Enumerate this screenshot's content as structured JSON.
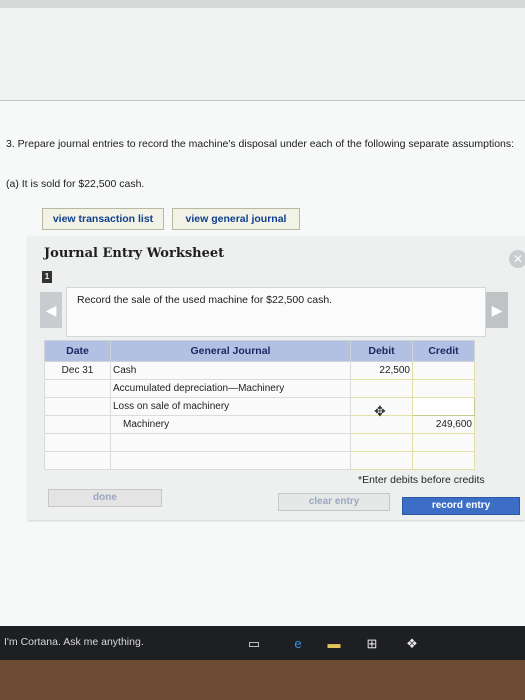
{
  "question": {
    "text": "3. Prepare journal entries to record the machine's disposal under each of the following separate assumptions:",
    "sub_a": "(a) It is sold for $22,500 cash."
  },
  "buttons": {
    "view_transaction_list": "view transaction list",
    "view_general_journal": "view general journal",
    "done": "done",
    "clear_entry": "clear entry",
    "record_entry": "record entry"
  },
  "worksheet": {
    "title": "Journal Entry Worksheet",
    "step": "1",
    "instruction": "Record the sale of the used machine for $22,500 cash.",
    "close_icon": "close-icon",
    "nav_left_icon": "chevron-left-icon",
    "nav_right_icon": "chevron-right-icon"
  },
  "journal": {
    "headers": [
      "Date",
      "General Journal",
      "Debit",
      "Credit"
    ],
    "rows": [
      {
        "date": "Dec 31",
        "account": "Cash",
        "debit": "22,500",
        "credit": ""
      },
      {
        "date": "",
        "account": "Accumulated depreciation—Machinery",
        "debit": "",
        "credit": ""
      },
      {
        "date": "",
        "account": "Loss on sale of machinery",
        "debit": "",
        "credit": ""
      },
      {
        "date": "",
        "account": "Machinery",
        "debit": "",
        "credit": "249,600"
      },
      {
        "date": "",
        "account": "",
        "debit": "",
        "credit": ""
      },
      {
        "date": "",
        "account": "",
        "debit": "",
        "credit": ""
      }
    ]
  },
  "note": "*Enter debits before credits",
  "taskbar": {
    "search_text": "I'm Cortana. Ask me anything.",
    "icons": [
      "task-view-icon",
      "edge-browser-icon",
      "file-explorer-icon",
      "store-icon",
      "dropbox-icon"
    ]
  },
  "colors": {
    "header_blue": "#b2c0e3",
    "record_button": "#3b6ec4",
    "link_blue": "#0f3f8e"
  }
}
